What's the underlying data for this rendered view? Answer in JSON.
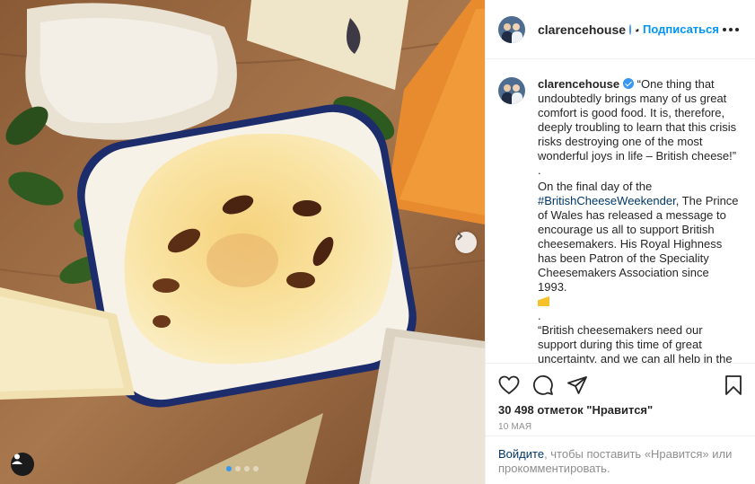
{
  "post": {
    "username": "clarencehouse",
    "follow_label": "Подписаться",
    "separator": "•",
    "caption_lines": [
      "“One thing that undoubtedly brings many of us great comfort is good food. It is, therefore, deeply troubling to learn that this crisis risks destroying one of the most wonderful joys in life – British cheese!”",
      ".",
      "On the final day of the ",
      "#BritishCheeseWeekender",
      ", The Prince of Wales has released a message to encourage us all to support British cheesemakers. His Royal Highness has been Patron of the Speciality Cheesemakers Association since 1993.",
      ".",
      "“British cheesemakers need our support during this time of great uncertainty, and we can all help in the simplest way. By sourcing British"
    ],
    "likes": "30 498 отметок \"Нравится\"",
    "date": "10 МАЯ",
    "login_link": "Войдите",
    "login_text": ", чтобы поставить «Нравится» или прокомментировать."
  },
  "icons": {
    "verified": "verified-badge-icon",
    "more": "more-options-icon",
    "like": "heart-icon",
    "comment": "comment-icon",
    "share": "share-icon",
    "save": "bookmark-icon",
    "next": "chevron-right-icon",
    "tag": "user-tag-icon",
    "emoji": "cheese-emoji-icon"
  },
  "colors": {
    "accent": "#0095f6",
    "hashtag": "#00376b",
    "muted": "#8e8e8e"
  },
  "carousel": {
    "total": 4,
    "active": 1
  }
}
